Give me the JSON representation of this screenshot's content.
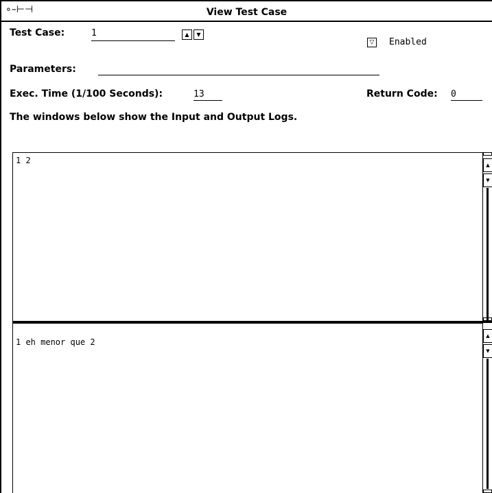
{
  "window": {
    "title": "View Test Case",
    "pin_icon": "⟔"
  },
  "test_case": {
    "label": "Test Case:",
    "value": "1"
  },
  "enabled": {
    "label": "Enabled",
    "checked": true
  },
  "parameters": {
    "label": "Parameters:",
    "value": ""
  },
  "exec_time": {
    "label": "Exec. Time (1/100 Seconds):",
    "value": "13"
  },
  "return_code": {
    "label": "Return Code:",
    "value": "0"
  },
  "info_text": "The windows below show the Input and Output Logs.",
  "input_log": {
    "text": "1 2"
  },
  "output_log": {
    "text": "1 eh menor que 2"
  }
}
